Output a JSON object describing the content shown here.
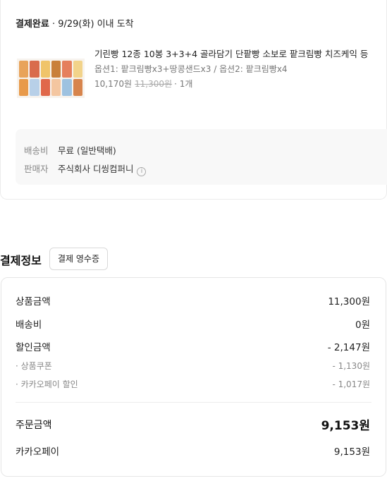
{
  "order": {
    "status_label": "결제완료",
    "delivery_text": " · 9/29(화) 이내 도착",
    "product": {
      "title": "기린빵 12종 10봉 3+3+4 골라담기 단팥빵 소보로 팥크림빵 치즈케익 등",
      "options": "옵션1: 팥크림빵x3+땅콩샌드x3 / 옵션2: 팥크림빵x4",
      "price": "10,170원",
      "original_price": "11,300원",
      "quantity": "· 1개"
    },
    "shipping": {
      "fee_label": "배송비",
      "fee_value": "무료 (일반택배)",
      "seller_label": "판매자",
      "seller_value": "주식회사 디씽컴퍼니",
      "info_icon": "info-icon"
    }
  },
  "payment": {
    "title": "결제정보",
    "receipt_button": "결제 영수증",
    "rows": {
      "product_amount": {
        "label": "상품금액",
        "value": "11,300원"
      },
      "shipping": {
        "label": "배송비",
        "value": "0원"
      },
      "discount": {
        "label": "할인금액",
        "value": "- 2,147원"
      },
      "coupon": {
        "label": "· 상품쿠폰",
        "value": "- 1,130원"
      },
      "kakao_discount": {
        "label": "· 카카오페이 할인",
        "value": "- 1,017원"
      },
      "order_total": {
        "label": "주문금액",
        "value": "9,153원"
      },
      "kakaopay": {
        "label": "카카오페이",
        "value": "9,153원"
      }
    }
  }
}
